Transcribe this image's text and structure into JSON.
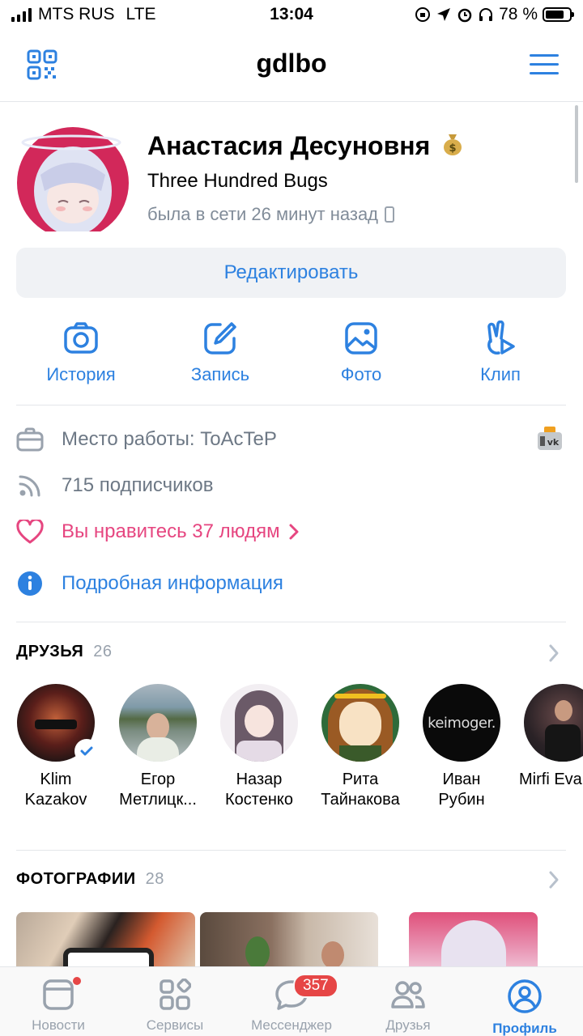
{
  "status_bar": {
    "carrier": "MTS RUS",
    "network": "LTE",
    "time": "13:04",
    "battery": "78 %",
    "battery_level": 0.78
  },
  "header": {
    "title": "gdlbo",
    "left_icon": "qr-code-icon",
    "right_icon": "menu-icon"
  },
  "profile": {
    "name": "Анастасия Десуновня",
    "badge_icon": "money-bag-icon",
    "status": "Three Hundred Bugs",
    "online": "была в сети 26 минут назад",
    "edit_label": "Редактировать"
  },
  "actions": [
    {
      "label": "История",
      "icon": "camera-icon"
    },
    {
      "label": "Запись",
      "icon": "edit-icon"
    },
    {
      "label": "Фото",
      "icon": "image-icon"
    },
    {
      "label": "Клип",
      "icon": "clip-icon"
    }
  ],
  "info": {
    "work": "Место работы: ToAcTeP",
    "followers": "715 подписчиков",
    "likes": "Вы нравитесь 37 людям",
    "details": "Подробная информация"
  },
  "friends": {
    "title": "ДРУЗЬЯ",
    "count": "26",
    "items": [
      {
        "first": "Klim",
        "last": "Kazakov",
        "verified": true
      },
      {
        "first": "Егор",
        "last": "Метлицк..."
      },
      {
        "first": "Назар",
        "last": "Костенко"
      },
      {
        "first": "Рита",
        "last": "Тайнакова"
      },
      {
        "first": "Иван",
        "last": "Рубин",
        "avatar_text": "keimoger."
      },
      {
        "first": "Mirfi Eva",
        "last": ""
      }
    ]
  },
  "photos": {
    "title": "ФОТОГРАФИИ",
    "count": "28"
  },
  "tabbar": {
    "tabs": [
      {
        "label": "Новости",
        "icon": "news-icon"
      },
      {
        "label": "Сервисы",
        "icon": "services-icon"
      },
      {
        "label": "Мессенджер",
        "icon": "messenger-icon",
        "badge": "357"
      },
      {
        "label": "Друзья",
        "icon": "friends-icon"
      },
      {
        "label": "Профиль",
        "icon": "profile-icon",
        "active": true
      }
    ]
  },
  "colors": {
    "accent": "#2d81e0",
    "pink": "#e64680",
    "badge": "#e64646"
  }
}
